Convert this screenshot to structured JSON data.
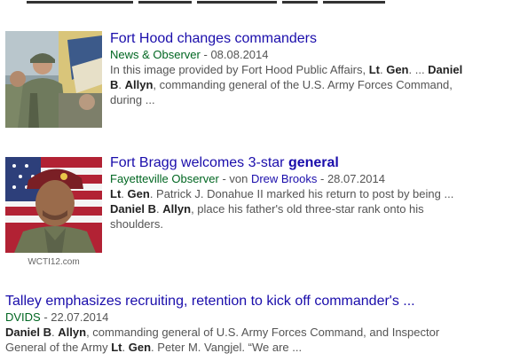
{
  "results": [
    {
      "title": "Fort Hood changes commanders",
      "source": "News & Observer",
      "sep": " - ",
      "date": "08.08.2014",
      "snippet_lines": [
        [
          {
            "t": "In this image provided by Fort Hood Public Affairs, ",
            "b": false
          },
          {
            "t": "Lt",
            "b": true
          },
          {
            "t": ". ",
            "b": false
          },
          {
            "t": "Gen",
            "b": true
          },
          {
            "t": ". ... ",
            "b": false
          },
          {
            "t": "Daniel",
            "b": true
          }
        ],
        [
          {
            "t": "B",
            "b": true
          },
          {
            "t": ". ",
            "b": false
          },
          {
            "t": "Allyn",
            "b": true
          },
          {
            "t": ", commanding general of the U.S. Army Forces Command,",
            "b": false
          }
        ],
        [
          {
            "t": "during ...",
            "b": false
          }
        ]
      ]
    },
    {
      "title_plain": "Fort Bragg welcomes 3-star ",
      "title_bold": "general",
      "source": "Fayetteville Observer",
      "von": " - von ",
      "author": "Drew Brooks",
      "sep": " - ",
      "date": "28.07.2014",
      "image_caption": "WCTI12.com",
      "snippet_lines": [
        [
          {
            "t": "Lt",
            "b": true
          },
          {
            "t": ". ",
            "b": false
          },
          {
            "t": "Gen",
            "b": true
          },
          {
            "t": ". Patrick J. Donahue II marked his return to post by being ...",
            "b": false
          }
        ],
        [
          {
            "t": "Daniel",
            "b": true
          },
          {
            "t": " ",
            "b": false
          },
          {
            "t": "B",
            "b": true
          },
          {
            "t": ". ",
            "b": false
          },
          {
            "t": "Allyn",
            "b": true
          },
          {
            "t": ", place his father's old three-star rank onto his",
            "b": false
          }
        ],
        [
          {
            "t": "shoulders.",
            "b": false
          }
        ]
      ]
    },
    {
      "title": "Talley emphasizes recruiting, retention to kick off commander's ...",
      "source": "DVIDS",
      "sep": " - ",
      "date": "22.07.2014",
      "snippet_lines": [
        [
          {
            "t": "Daniel",
            "b": true
          },
          {
            "t": " ",
            "b": false
          },
          {
            "t": "B",
            "b": true
          },
          {
            "t": ". ",
            "b": false
          },
          {
            "t": "Allyn",
            "b": true
          },
          {
            "t": ", commanding general of U.S. Army Forces Command, and Inspector",
            "b": false
          }
        ],
        [
          {
            "t": "General of the Army ",
            "b": false
          },
          {
            "t": "Lt",
            "b": true
          },
          {
            "t": ". ",
            "b": false
          },
          {
            "t": "Gen",
            "b": true
          },
          {
            "t": ". Peter M. Vangjel. “We are ...",
            "b": false
          }
        ]
      ]
    }
  ],
  "colors": {
    "link": "#1a0dab",
    "source": "#006621",
    "snippet": "#545454",
    "bold": "#222222"
  }
}
